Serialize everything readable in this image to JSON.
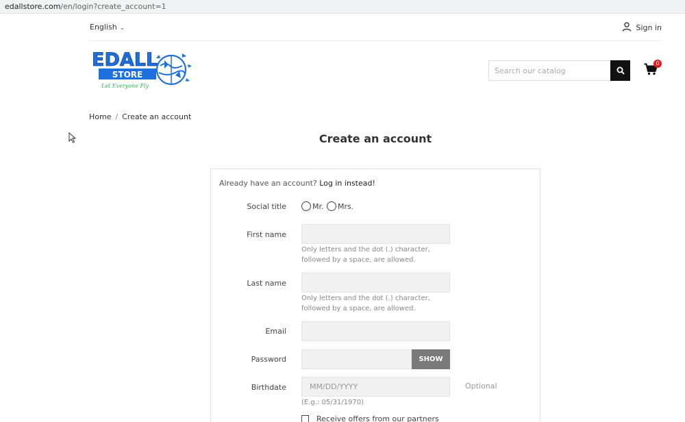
{
  "browser": {
    "url_host": "edallstore.com",
    "url_path": "/en/login?create_account=1"
  },
  "header": {
    "language": "English",
    "signin_label": "Sign in",
    "logo": {
      "word": "EDALL",
      "store": "STORE",
      "tagline": "Let Everyone Fly"
    },
    "search_placeholder": "Search our catalog",
    "cart_count": "0"
  },
  "breadcrumb": {
    "home": "Home",
    "separator": "/",
    "current": "Create an account"
  },
  "page_title": "Create an account",
  "form": {
    "already_text": "Already have an account?",
    "login_link": "Log in instead!",
    "social_title_label": "Social title",
    "social_title_options": [
      "Mr.",
      "Mrs."
    ],
    "first_name_label": "First name",
    "first_name_hint_1": "Only letters and the dot (.) character,",
    "first_name_hint_2": "followed by a space, are allowed.",
    "last_name_label": "Last name",
    "last_name_hint_1": "Only letters and the dot (.) character,",
    "last_name_hint_2": "followed by a space, are allowed.",
    "email_label": "Email",
    "password_label": "Password",
    "show_button": "SHOW",
    "birthdate_label": "Birthdate",
    "birthdate_placeholder": "MM/DD/YYYY",
    "birthdate_example": "(E.g.: 05/31/1970)",
    "optional_label": "Optional",
    "offers_label": "Receive offers from our partners"
  },
  "colors": {
    "logo_blue": "#1e6fe0",
    "logo_green": "#2fb34a",
    "badge_red": "#e61b1b",
    "show_button_bg": "#7a7a7a"
  }
}
